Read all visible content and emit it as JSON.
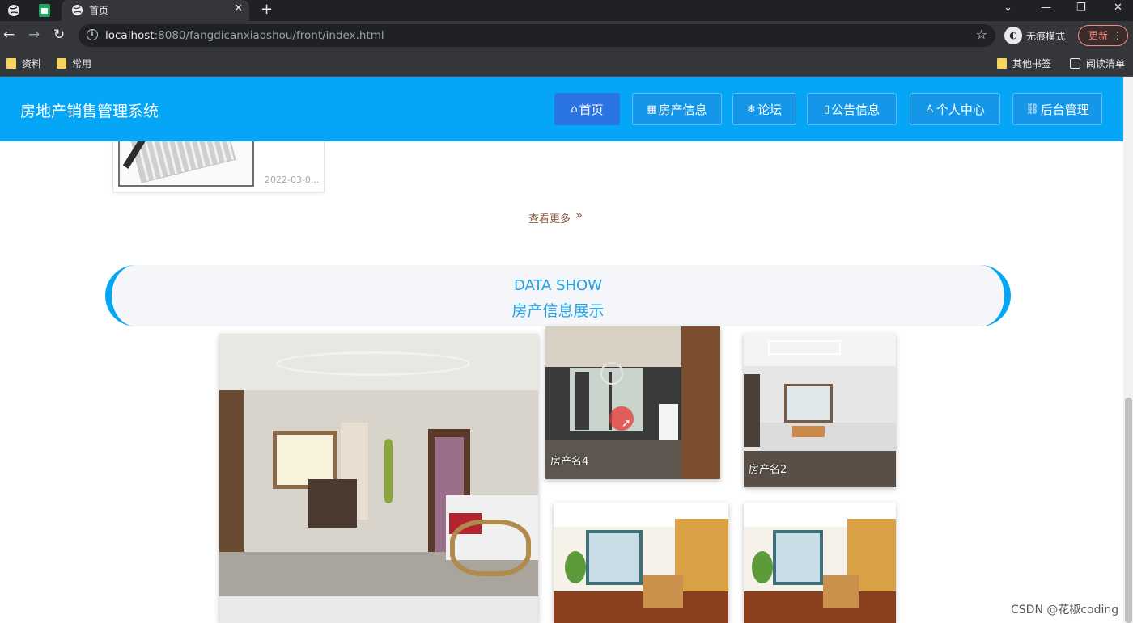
{
  "browser": {
    "active_tab_title": "首页",
    "url_host": "localhost",
    "url_path": ":8080/fangdicanxiaoshou/front/index.html",
    "incognito_label": "无痕模式",
    "update_label": "更新",
    "bookmarks": [
      "资料",
      "常用"
    ],
    "bookmarks_right": [
      "其他书签",
      "阅读清单"
    ]
  },
  "site": {
    "title": "房地产销售管理系统",
    "nav": [
      {
        "icon": "⌂",
        "label": "首页",
        "active": true
      },
      {
        "icon": "▦",
        "label": "房产信息",
        "active": false
      },
      {
        "icon": "❄",
        "label": "论坛",
        "active": false
      },
      {
        "icon": "▯",
        "label": "公告信息",
        "active": false
      },
      {
        "icon": "♙",
        "label": "个人中心",
        "active": false
      },
      {
        "icon": "⛓",
        "label": "后台管理",
        "active": false
      }
    ]
  },
  "news": {
    "date": "2022-03-0...",
    "see_more": "查看更多"
  },
  "data_show": {
    "title_en": "DATA SHOW",
    "title_cn": "房产信息展示"
  },
  "properties": [
    {
      "caption": ""
    },
    {
      "caption": "房产名4"
    },
    {
      "caption": "房产名2"
    },
    {
      "caption": ""
    },
    {
      "caption": ""
    }
  ],
  "watermark": "CSDN @花椒coding",
  "colors": {
    "header_blue": "#05a6f6",
    "nav_active": "#2a74e6",
    "accent_text": "#21a3e8"
  }
}
